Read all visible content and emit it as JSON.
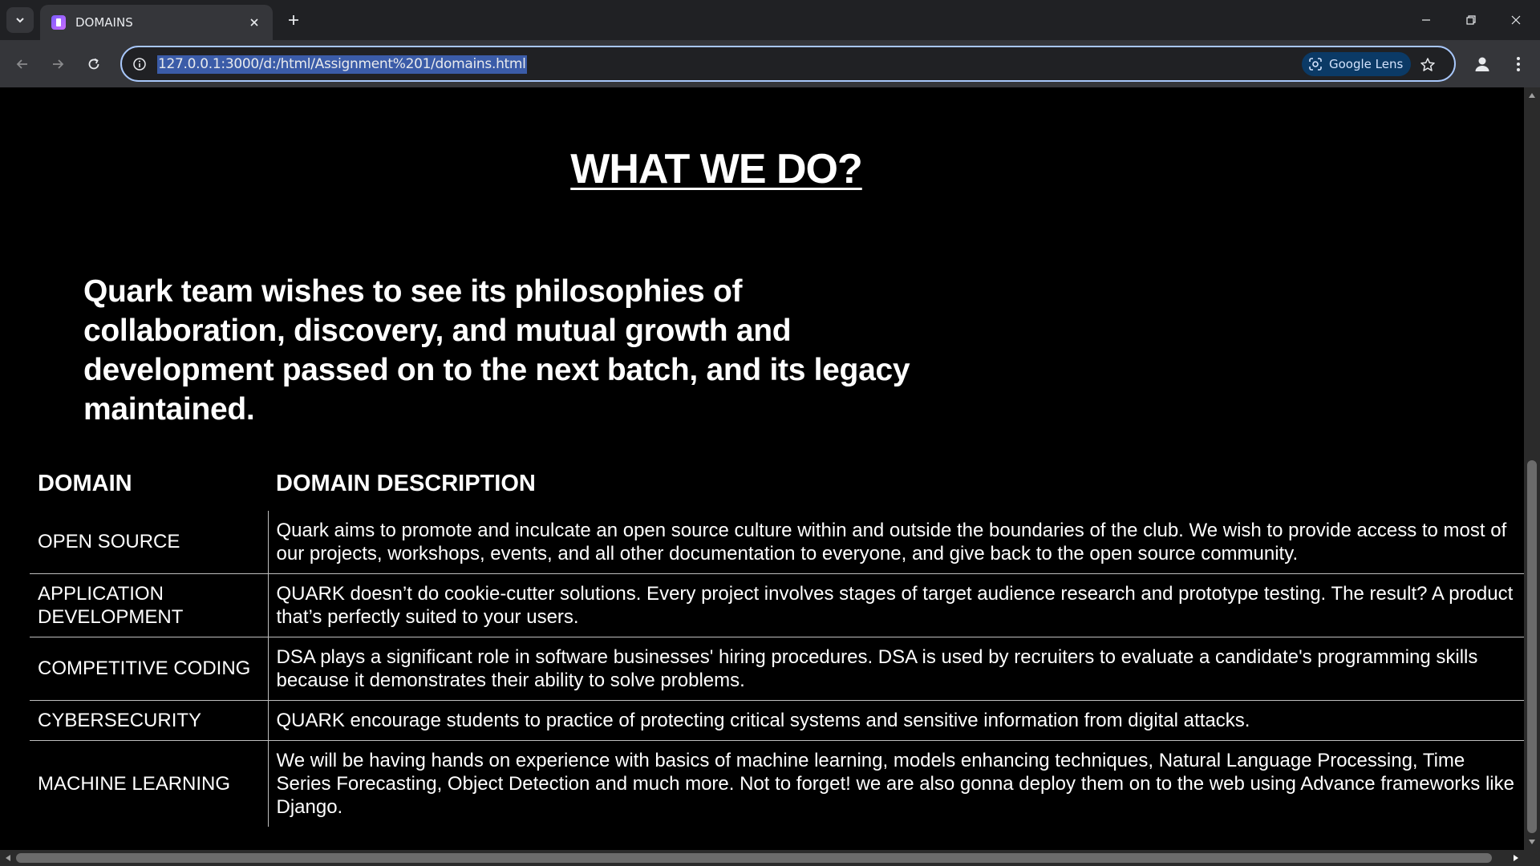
{
  "browser": {
    "tab_title": "DOMAINS",
    "url": "127.0.0.1:3000/d:/html/Assignment%201/domains.html",
    "lens_label": "Google Lens"
  },
  "page": {
    "heading": "WHAT WE DO?",
    "intro": "Quark team wishes to see its philosophies of collaboration, discovery, and mutual growth and development passed on to the next batch, and its legacy maintained.",
    "table": {
      "headers": [
        "DOMAIN",
        "DOMAIN DESCRIPTION"
      ],
      "rows": [
        {
          "domain": "OPEN SOURCE",
          "description": "Quark aims to promote and inculcate an open source culture within and outside the boundaries of the club. We wish to provide access to most of our projects, workshops, events, and all other documentation to everyone, and give back to the open source community."
        },
        {
          "domain": "APPLICATION DEVELOPMENT",
          "description": "QUARK doesn’t do cookie-cutter solutions. Every project involves stages of target audience research and prototype testing. The result? A product that’s perfectly suited to your users."
        },
        {
          "domain": "COMPETITIVE CODING",
          "description": "DSA plays a significant role in software businesses' hiring procedures. DSA is used by recruiters to evaluate a candidate's programming skills because it demonstrates their ability to solve problems."
        },
        {
          "domain": "CYBERSECURITY",
          "description": "QUARK encourage students to practice of protecting critical systems and sensitive information from digital attacks."
        },
        {
          "domain": "MACHINE LEARNING",
          "description": "We will be having hands on experience with basics of machine learning, models enhancing techniques, Natural Language Processing, Time Series Forecasting, Object Detection and much more. Not to forget! we are also gonna deploy them on to the web using Advance frameworks like Django."
        }
      ]
    }
  },
  "icons": {
    "tab_list": "chevron-down-icon",
    "close": "close-icon",
    "new_tab": "plus-icon",
    "back": "arrow-left-icon",
    "forward": "arrow-right-icon",
    "reload": "reload-icon",
    "site_info": "info-icon",
    "lens": "google-lens-icon",
    "bookmark": "star-icon",
    "profile": "person-icon",
    "menu": "kebab-menu-icon"
  }
}
